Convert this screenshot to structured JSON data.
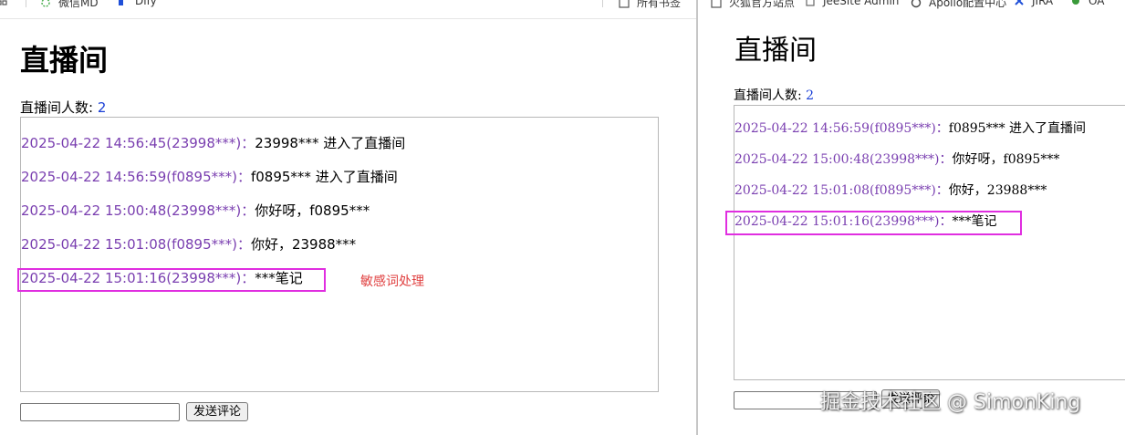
{
  "left_window": {
    "bookmarks": [
      {
        "label": "",
        "icon": "apps-grid-icon"
      },
      {
        "label": "微信MD",
        "icon": "wechat-md-icon"
      },
      {
        "label": "Dify",
        "icon": "dify-icon"
      },
      {
        "label": "所有书签",
        "icon": "folder-icon"
      }
    ],
    "title": "直播间",
    "viewer_label": "直播间人数:",
    "viewer_count": "2",
    "messages": [
      {
        "meta": "2025-04-22 14:56:45(23998***)：",
        "text": "23998*** 进入了直播间"
      },
      {
        "meta": "2025-04-22 14:56:59(f0895***)：",
        "text": "f0895*** 进入了直播间"
      },
      {
        "meta": "2025-04-22 15:00:48(23998***)：",
        "text": "你好呀，f0895***"
      },
      {
        "meta": "2025-04-22 15:01:08(f0895***)：",
        "text": "你好，23988***"
      },
      {
        "meta": "2025-04-22 15:01:16(23998***)：",
        "text": "***笔记"
      }
    ],
    "annotation": "敏感词处理",
    "comment_input_value": "",
    "send_button_label": "发送评论"
  },
  "right_window": {
    "bookmarks": [
      {
        "label": "火狐官方站点",
        "icon": "firefox-icon"
      },
      {
        "label": "JeeSite Admin",
        "icon": "jeesite-icon"
      },
      {
        "label": "Apollo配置中心",
        "icon": "apollo-icon"
      },
      {
        "label": "JIRA",
        "icon": "jira-icon"
      },
      {
        "label": "OA",
        "icon": "oa-icon"
      }
    ],
    "title": "直播间",
    "viewer_label": "直播间人数:",
    "viewer_count": "2",
    "messages": [
      {
        "meta": "2025-04-22 14:56:59(f0895***)：",
        "text": "f0895*** 进入了直播间"
      },
      {
        "meta": "2025-04-22 15:00:48(23998***)：",
        "text": "你好呀，f0895***"
      },
      {
        "meta": "2025-04-22 15:01:08(f0895***)：",
        "text": "你好，23988***"
      },
      {
        "meta": "2025-04-22 15:01:16(23998***)：",
        "text": "***笔记"
      }
    ],
    "comment_input_value": "",
    "send_button_label": "发送评论",
    "watermark": "掘金技术社区 @ SimonKing"
  },
  "colors": {
    "meta_text": "#7a3fb0",
    "count_text": "#1a3fd6",
    "highlight_box": "#e02ee0",
    "annotation_text": "#e04040"
  }
}
